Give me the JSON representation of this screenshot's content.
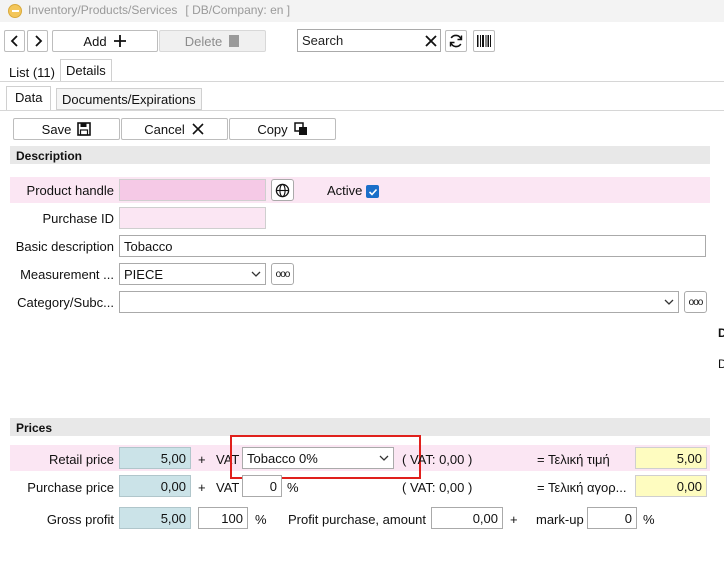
{
  "window": {
    "title": "Inventory/Products/Services",
    "db_info": "[ DB/Company: en ]"
  },
  "toolbar": {
    "back_icon": "chevron-left-icon",
    "forward_icon": "chevron-right-icon",
    "add_label": "Add",
    "delete_label": "Delete",
    "search_placeholder": "Search"
  },
  "tabs": {
    "list_label": "List (11)",
    "details_label": "Details"
  },
  "subtabs": {
    "data_label": "Data",
    "documents_label": "Documents/Expirations"
  },
  "actions": {
    "save_label": "Save",
    "cancel_label": "Cancel",
    "copy_label": "Copy"
  },
  "description": {
    "header": "Description",
    "product_handle_label": "Product handle",
    "product_handle_value": "",
    "active_label": "Active",
    "active_checked": true,
    "purchase_id_label": "Purchase ID",
    "purchase_id_value": "",
    "basic_description_label": "Basic description",
    "basic_description_value": "Tobacco",
    "measurement_label": "Measurement ...",
    "measurement_value": "PIECE",
    "category_label": "Category/Subc...",
    "category_value": "",
    "more_label": "ooo"
  },
  "side_clipped": {
    "a": "D",
    "b": "D"
  },
  "prices": {
    "header": "Prices",
    "retail_price_label": "Retail price",
    "retail_price_value": "5,00",
    "plus": "+",
    "vat_label": "VAT",
    "vat_selected": "Tobacco 0%",
    "retail_vat_text": "( VAT: 0,00 )",
    "final_price_label": "= Τελική τιμή",
    "final_price_value": "5,00",
    "purchase_price_label": "Purchase price",
    "purchase_price_value": "0,00",
    "purchase_vat_value": "0",
    "percent": "%",
    "purchase_vat_text": "( VAT: 0,00 )",
    "final_purchase_label": "= Τελική αγορ...",
    "final_purchase_value": "0,00",
    "gross_profit_label": "Gross profit",
    "gross_profit_value": "5,00",
    "gross_profit_percent": "100",
    "profit_purchase_label": "Profit purchase, amount",
    "profit_purchase_value": "0,00",
    "markup_label": "mark-up",
    "markup_value": "0"
  },
  "colors": {
    "highlight": "#e0201c",
    "pink_field": "#f5c9e6",
    "blue_field": "#cbe3e8",
    "yellow_field": "#fefcc0",
    "checkbox": "#1a6fc9"
  }
}
